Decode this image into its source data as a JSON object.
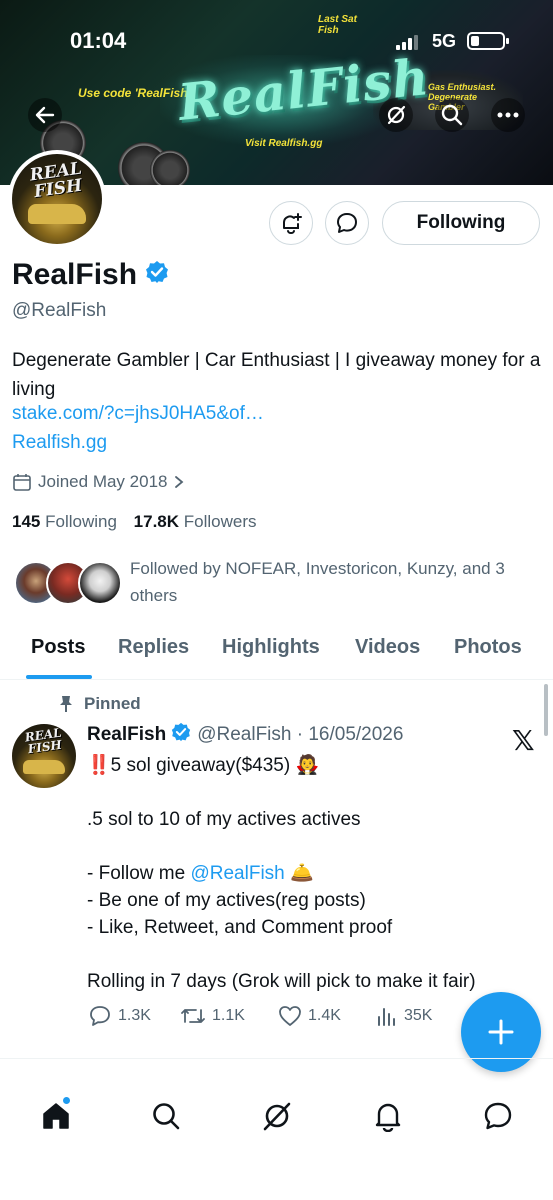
{
  "status_bar": {
    "time": "01:04",
    "network": "5G"
  },
  "banner": {
    "title": "RealFish",
    "small_texts": [
      "Use code 'RealFish'",
      "Last Sat Fish",
      "Visit Realfish.gg",
      "Gas Enthusiast. Degenerate Gambler"
    ]
  },
  "profile": {
    "avatar_text": "REAL FISH",
    "name": "RealFish",
    "handle": "@RealFish",
    "bio": "Degenerate Gambler | Car Enthusiast | I giveaway money for a living",
    "link1": "stake.com/?c=jhsJ0HA5&of…",
    "link2": "Realfish.gg",
    "joined": "Joined May 2018",
    "following_count": "145",
    "following_label": "Following",
    "followers_count": "17.8K",
    "followers_label": "Followers",
    "followed_by": "Followed by NOFEAR, Investoricon, Kunzy, and 3 others",
    "following_button": "Following"
  },
  "tabs": [
    {
      "label": "Posts",
      "active": true
    },
    {
      "label": "Replies",
      "active": false
    },
    {
      "label": "Highlights",
      "active": false
    },
    {
      "label": "Videos",
      "active": false
    },
    {
      "label": "Photos",
      "active": false
    }
  ],
  "post": {
    "pinned_label": "Pinned",
    "author": "RealFish",
    "handle_date": "@RealFish · 16/05/2026",
    "lines": [
      "‼️5 sol giveaway($435) 🧛",
      "",
      ".5 sol to 10 of my actives actives",
      "",
      "- Follow me ",
      "- Be one of my actives(reg posts)",
      "- Like, Retweet, and Comment proof",
      "",
      "Rolling in 7 days (Grok will pick to make it fair)"
    ],
    "mention": "@RealFish",
    "mention_suffix": " 🛎️",
    "replies": "1.3K",
    "retweets": "1.1K",
    "likes": "1.4K",
    "views": "35K"
  },
  "colors": {
    "accent": "#1d9bf0",
    "text": "#0f1419",
    "muted": "#536471"
  }
}
